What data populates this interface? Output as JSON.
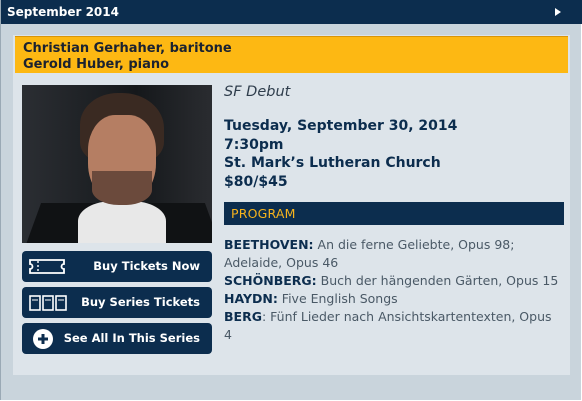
{
  "header": {
    "month_label": "September 2014",
    "next_icon": "triangle-right-icon"
  },
  "banner": {
    "line1": "Christian Gerhaher, baritone",
    "line2": "Gerold Huber, piano"
  },
  "photo": {
    "icon": "artist-portrait"
  },
  "buttons": {
    "buy_tickets": {
      "label": "Buy Tickets Now",
      "icon": "ticket-icon"
    },
    "buy_series": {
      "label": "Buy Series Tickets",
      "icon": "tickets-stack-icon"
    },
    "see_series": {
      "label": "See All In This Series",
      "icon": "plus-circle-icon"
    }
  },
  "event": {
    "tagline": "SF Debut",
    "date": "Tuesday, September 30, 2014",
    "time": "7:30pm",
    "venue": "St. Mark’s Lutheran Church",
    "price": "$80/$45"
  },
  "program": {
    "heading": "PROGRAM",
    "items": [
      {
        "composer": "BEETHOVEN:",
        "work": " An die ferne Geliebte, Opus 98; Adelaide, Opus 46"
      },
      {
        "composer": "SCHÖNBERG:",
        "work": " Buch der hängenden Gärten, Opus 15"
      },
      {
        "composer": "HAYDN:",
        "work": " Five English Songs"
      },
      {
        "composer": "BERG",
        "work": ": Fünf Lieder nach Ansichtskartentexten, Opus 4"
      }
    ]
  },
  "colors": {
    "navy": "#0c2d4e",
    "gold": "#fdb813",
    "panel": "#dde4ea",
    "frame": "#c9d4dc"
  }
}
